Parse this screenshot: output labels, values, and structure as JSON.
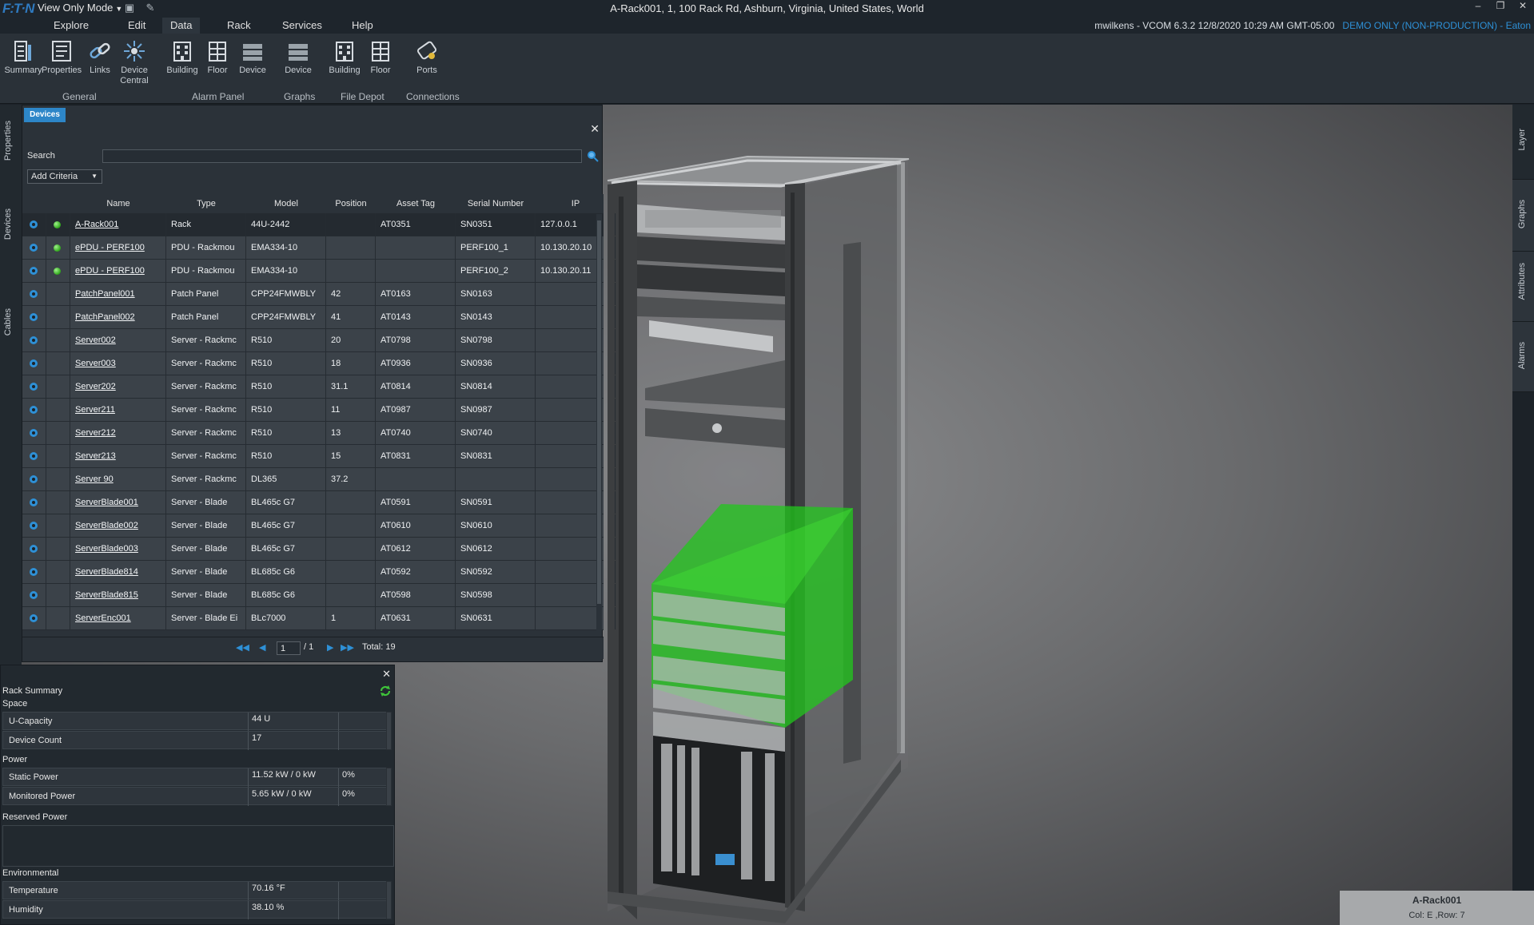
{
  "window": {
    "logo": "F:T·N",
    "view_mode": "View Only Mode",
    "title": "A-Rack001, 1, 100 Rack Rd, Ashburn, Virginia, United States, World",
    "controls": [
      "–",
      "❐",
      "✕"
    ]
  },
  "menu": {
    "items": [
      "Explore",
      "Edit",
      "Data",
      "Rack",
      "Services",
      "Help"
    ],
    "active": "Data",
    "status_user": "mwilkens - VCOM 6.3.2   12/8/2020 10:29 AM GMT-05:00",
    "status_demo": "DEMO ONLY (NON-PRODUCTION) - Eaton"
  },
  "ribbon": {
    "buttons": [
      {
        "label": "Summary",
        "icon": "summary-icon"
      },
      {
        "label": "Properties",
        "icon": "properties-icon"
      },
      {
        "label": "Links",
        "icon": "links-icon"
      },
      {
        "label": "Device Central",
        "icon": "device-central-icon"
      },
      {
        "label": "Building",
        "icon": "building-icon"
      },
      {
        "label": "Floor",
        "icon": "floor-icon"
      },
      {
        "label": "Device",
        "icon": "device-icon"
      },
      {
        "label": "Device",
        "icon": "device-graph-icon"
      },
      {
        "label": "Building",
        "icon": "building-depot-icon"
      },
      {
        "label": "Floor",
        "icon": "floor-depot-icon"
      },
      {
        "label": "Ports",
        "icon": "ports-icon"
      }
    ],
    "groups": [
      "General",
      "Alarm Panel",
      "Graphs",
      "File Depot",
      "Connections"
    ]
  },
  "left_tabs": [
    "Properties",
    "Devices",
    "Cables"
  ],
  "right_tabs": [
    "Layer",
    "Graphs",
    "Attributes",
    "Alarms"
  ],
  "devices_panel": {
    "tab_label": "Devices",
    "search_label": "Search",
    "search_value": "",
    "add_criteria": "Add Criteria",
    "columns": [
      "Name",
      "Type",
      "Model",
      "Position",
      "Asset Tag",
      "Serial Number",
      "IP"
    ],
    "rows": [
      {
        "name": "A-Rack001",
        "type": "Rack",
        "model": "44U-2442",
        "position": "",
        "asset": "AT0351",
        "serial": "SN0351",
        "ip": "127.0.0.1",
        "status": true
      },
      {
        "name": "ePDU - PERF100",
        "type": "PDU - Rackmou",
        "model": "EMA334-10",
        "position": "",
        "asset": "",
        "serial": "PERF100_1",
        "ip": "10.130.20.10",
        "status": true
      },
      {
        "name": "ePDU - PERF100",
        "type": "PDU - Rackmou",
        "model": "EMA334-10",
        "position": "",
        "asset": "",
        "serial": "PERF100_2",
        "ip": "10.130.20.11",
        "status": true
      },
      {
        "name": "PatchPanel001",
        "type": "Patch Panel",
        "model": "CPP24FMWBLY",
        "position": "42",
        "asset": "AT0163",
        "serial": "SN0163",
        "ip": "",
        "status": false
      },
      {
        "name": "PatchPanel002",
        "type": "Patch Panel",
        "model": "CPP24FMWBLY",
        "position": "41",
        "asset": "AT0143",
        "serial": "SN0143",
        "ip": "",
        "status": false
      },
      {
        "name": "Server002",
        "type": "Server - Rackmc",
        "model": "R510",
        "position": "20",
        "asset": "AT0798",
        "serial": "SN0798",
        "ip": "",
        "status": false
      },
      {
        "name": "Server003",
        "type": "Server - Rackmc",
        "model": "R510",
        "position": "18",
        "asset": "AT0936",
        "serial": "SN0936",
        "ip": "",
        "status": false
      },
      {
        "name": "Server202",
        "type": "Server - Rackmc",
        "model": "R510",
        "position": "31.1",
        "asset": "AT0814",
        "serial": "SN0814",
        "ip": "",
        "status": false
      },
      {
        "name": "Server211",
        "type": "Server - Rackmc",
        "model": "R510",
        "position": "11",
        "asset": "AT0987",
        "serial": "SN0987",
        "ip": "",
        "status": false
      },
      {
        "name": "Server212",
        "type": "Server - Rackmc",
        "model": "R510",
        "position": "13",
        "asset": "AT0740",
        "serial": "SN0740",
        "ip": "",
        "status": false
      },
      {
        "name": "Server213",
        "type": "Server - Rackmc",
        "model": "R510",
        "position": "15",
        "asset": "AT0831",
        "serial": "SN0831",
        "ip": "",
        "status": false
      },
      {
        "name": "Server 90",
        "type": "Server - Rackmc",
        "model": "DL365",
        "position": "37.2",
        "asset": "",
        "serial": "",
        "ip": "",
        "status": false
      },
      {
        "name": "ServerBlade001",
        "type": "Server - Blade",
        "model": "BL465c G7",
        "position": "",
        "asset": "AT0591",
        "serial": "SN0591",
        "ip": "",
        "status": false
      },
      {
        "name": "ServerBlade002",
        "type": "Server - Blade",
        "model": "BL465c G7",
        "position": "",
        "asset": "AT0610",
        "serial": "SN0610",
        "ip": "",
        "status": false
      },
      {
        "name": "ServerBlade003",
        "type": "Server - Blade",
        "model": "BL465c G7",
        "position": "",
        "asset": "AT0612",
        "serial": "SN0612",
        "ip": "",
        "status": false
      },
      {
        "name": "ServerBlade814",
        "type": "Server - Blade",
        "model": "BL685c G6",
        "position": "",
        "asset": "AT0592",
        "serial": "SN0592",
        "ip": "",
        "status": false
      },
      {
        "name": "ServerBlade815",
        "type": "Server - Blade",
        "model": "BL685c G6",
        "position": "",
        "asset": "AT0598",
        "serial": "SN0598",
        "ip": "",
        "status": false
      },
      {
        "name": "ServerEnc001",
        "type": "Server - Blade Ei",
        "model": "BLc7000",
        "position": "1",
        "asset": "AT0631",
        "serial": "SN0631",
        "ip": "",
        "status": false
      }
    ],
    "pager": {
      "page": "1",
      "of": "/ 1",
      "total": "Total: 19"
    }
  },
  "rack_summary": {
    "title": "Rack Summary",
    "space_label": "Space",
    "u_capacity_label": "U-Capacity",
    "u_capacity": "44 U",
    "device_count_label": "Device Count",
    "device_count": "17",
    "power_label": "Power",
    "static_power_label": "Static Power",
    "static_power": "11.52 kW / 0 kW",
    "static_power_pct": "0%",
    "monitored_power_label": "Monitored Power",
    "monitored_power": "5.65 kW / 0 kW",
    "monitored_power_pct": "0%",
    "reserved_label": "Reserved Power",
    "env_label": "Environmental",
    "temperature_label": "Temperature",
    "temperature": "70.16 °F",
    "humidity_label": "Humidity",
    "humidity": "38.10 %"
  },
  "location": {
    "name": "A-Rack001",
    "coords": "Col: E ,Row: 7"
  },
  "colors": {
    "accent": "#2d86c8",
    "demo": "#2e90d6",
    "status_ok": "#2ea61a",
    "highlight": "#22c81c"
  }
}
